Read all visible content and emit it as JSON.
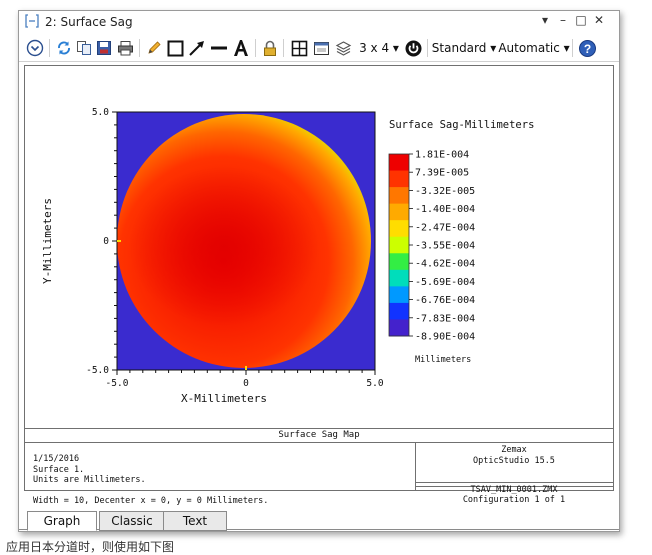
{
  "window": {
    "title": "2: Surface Sag"
  },
  "toolbar": {
    "layout_label": "3 x 4 ▾",
    "standard_label": "Standard ▾",
    "automatic_label": "Automatic ▾"
  },
  "chart_data": {
    "type": "heatmap",
    "xlabel": "X-Millimeters",
    "ylabel": "Y-Millimeters",
    "xlim": [
      -5.0,
      5.0
    ],
    "ylim": [
      -5.0,
      5.0
    ],
    "x_ticks": [
      "-5.0",
      "0",
      "5.0"
    ],
    "y_ticks": [
      "5.0",
      "0",
      "-5.0"
    ],
    "legend_title": "Surface Sag-Millimeters",
    "legend_values": [
      "1.81E-004",
      "7.39E-005",
      "-3.32E-005",
      "-1.40E-004",
      "-2.47E-004",
      "-3.55E-004",
      "-4.62E-004",
      "-5.69E-004",
      "-6.76E-004",
      "-7.83E-004",
      "-8.90E-004"
    ],
    "legend_units": "Millimeters",
    "legend_colors": [
      "#ee0000",
      "#ff3300",
      "#ff7700",
      "#ffaa00",
      "#ffdd00",
      "#ccff00",
      "#33ee44",
      "#00ddbb",
      "#0099ff",
      "#1133ff",
      "#4422cc"
    ],
    "background_color": "#3a2bcf"
  },
  "info": {
    "caption": "Surface Sag Map",
    "lines": [
      "1/15/2016",
      "Surface 1.",
      "Units are Millimeters.",
      "",
      "Width = 10, Decenter x = 0, y = 0 Millimeters."
    ],
    "company": "Zemax",
    "product": "OpticStudio 15.5",
    "file": "TSAV_MIN_0001.ZMX",
    "config": "Configuration 1 of 1"
  },
  "tabs": [
    {
      "label": "Graph"
    },
    {
      "label": "Classic"
    },
    {
      "label": "Text"
    }
  ],
  "footer": {
    "text": "应用日本分道时，则使用如下图"
  },
  "icons": [
    "expand-icon",
    "refresh-icon",
    "copy-icon",
    "save-icon",
    "print-icon",
    "pencil-icon",
    "rectangle-icon",
    "arrow-icon",
    "line-icon",
    "text-icon",
    "lock-icon",
    "grid-icon",
    "window-icon",
    "layers-icon",
    "power-icon",
    "help-icon"
  ]
}
